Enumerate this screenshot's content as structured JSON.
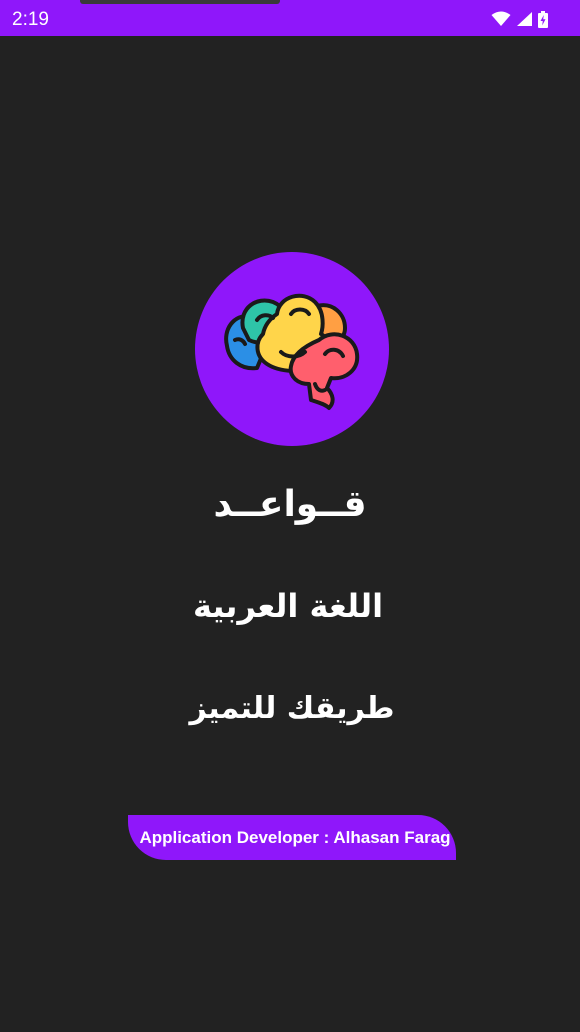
{
  "status_bar": {
    "time": "2:19",
    "icons": [
      "wifi-icon",
      "signal-icon",
      "battery-charging-icon"
    ],
    "color": "#8f17fa"
  },
  "logo": {
    "icon": "brain-icon",
    "background": "#8f17fa"
  },
  "titles": {
    "line1": "قــواعــد",
    "line2": "اللغة العربية",
    "line3": "طريقك للتميز"
  },
  "developer": {
    "label": "Application Developer : Alhasan Farag"
  },
  "colors": {
    "accent": "#8f17fa",
    "background": "#222222",
    "text": "#ffffff"
  }
}
